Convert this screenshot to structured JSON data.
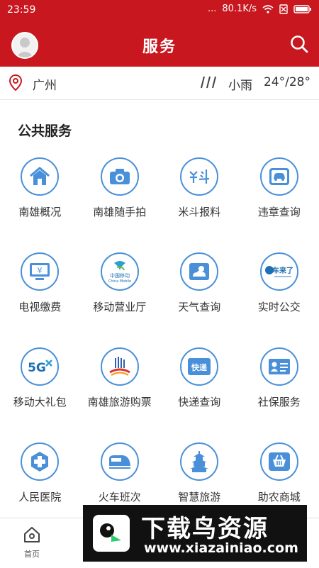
{
  "status_bar": {
    "time": "23:59",
    "signal": "...",
    "speed": "80.1K/s",
    "battery": "battery-icon"
  },
  "header": {
    "title": "服务"
  },
  "weather": {
    "city": "广州",
    "condition": "小雨",
    "temperature": "24°/28°"
  },
  "section": {
    "title": "公共服务"
  },
  "services": [
    {
      "label": "南雄概况",
      "icon": "house-icon"
    },
    {
      "label": "南雄随手拍",
      "icon": "camera-icon"
    },
    {
      "label": "米斗报料",
      "icon": "mi-dou-icon"
    },
    {
      "label": "违章查询",
      "icon": "car-icon"
    },
    {
      "label": "电视缴费",
      "icon": "tv-yen-icon"
    },
    {
      "label": "移动营业厅",
      "icon": "china-mobile-icon",
      "icon_text": "中国移动",
      "icon_subtext": "China Mobile"
    },
    {
      "label": "天气查询",
      "icon": "weather-icon"
    },
    {
      "label": "实时公交",
      "icon": "bus-icon",
      "icon_text": "车来了"
    },
    {
      "label": "移动大礼包",
      "icon": "5g-icon",
      "icon_text": "5G"
    },
    {
      "label": "南雄旅游购票",
      "icon": "ticket-icon"
    },
    {
      "label": "快递查询",
      "icon": "express-icon",
      "icon_text": "快递"
    },
    {
      "label": "社保服务",
      "icon": "id-card-icon"
    },
    {
      "label": "人民医院",
      "icon": "hospital-cross-icon"
    },
    {
      "label": "火车班次",
      "icon": "train-icon"
    },
    {
      "label": "智慧旅游",
      "icon": "pagoda-icon"
    },
    {
      "label": "助农商城",
      "icon": "basket-icon"
    }
  ],
  "tabbar": {
    "home_label": "首页"
  },
  "watermark": {
    "title": "下载鸟资源",
    "url": "www.xiazainiao.com"
  },
  "colors": {
    "brand_red": "#c8171e",
    "icon_blue": "#4a90d9"
  }
}
